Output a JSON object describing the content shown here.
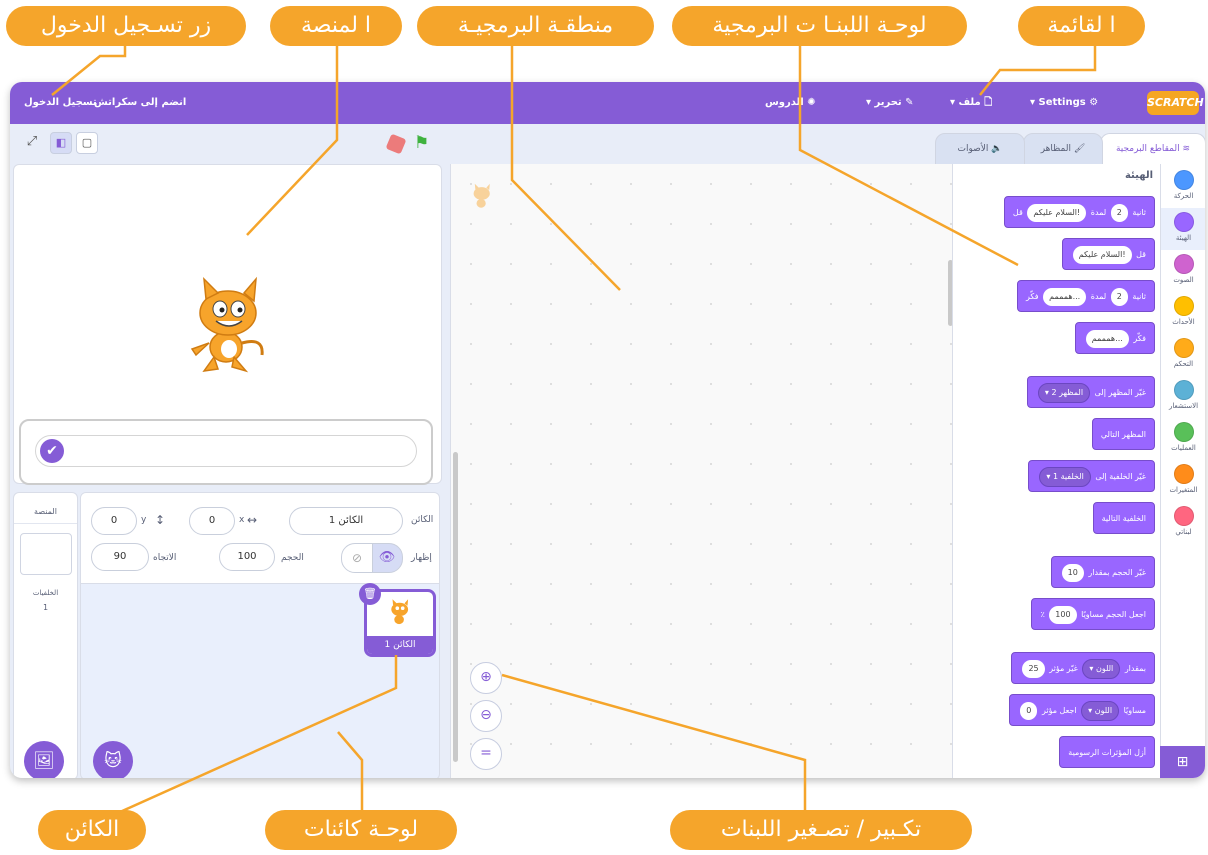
{
  "menu": {
    "logo": "SCRATCH",
    "settings": "Settings",
    "file": "ملف",
    "edit": "تحرير",
    "tutorials": "الدروس",
    "join": "انضم إلى سكراتش",
    "signin": "تسجيل الدخول"
  },
  "tabs": {
    "code": "المقاطع البرمجية",
    "costumes": "المظاهر",
    "sounds": "الأصوات"
  },
  "categories": [
    {
      "label": "الحركة",
      "color": "#4c97ff"
    },
    {
      "label": "الهيئة",
      "color": "#9966ff"
    },
    {
      "label": "الصوت",
      "color": "#cf63cf"
    },
    {
      "label": "الأحداث",
      "color": "#ffbf00"
    },
    {
      "label": "التحكم",
      "color": "#ffab19"
    },
    {
      "label": "الاستشعار",
      "color": "#5cb1d6"
    },
    {
      "label": "العمليات",
      "color": "#59c059"
    },
    {
      "label": "المتغيرات",
      "color": "#ff8c1a"
    },
    {
      "label": "لبناتي",
      "color": "#ff6680"
    }
  ],
  "palette": {
    "title": "الهيئة",
    "say_for": {
      "say": "قل",
      "text": "السلام عليكم!",
      "for": "لمدة",
      "secs": "2",
      "unit": "ثانية"
    },
    "say": {
      "say": "قل",
      "text": "السلام عليكم!"
    },
    "think_for": {
      "think": "فكّر",
      "text": "همممم...",
      "for": "لمدة",
      "secs": "2",
      "unit": "ثانية"
    },
    "think": {
      "think": "فكّر",
      "text": "همممم..."
    },
    "switch_costume": {
      "label": "غيّر المظهر إلى",
      "value": "المظهر 2"
    },
    "next_costume": "المظهر التالي",
    "switch_backdrop": {
      "label": "غيّر الخلفية إلى",
      "value": "الخلفية 1"
    },
    "next_backdrop": "الخلفية التالية",
    "change_size": {
      "label": "غيّر الحجم بمقدار",
      "value": "10"
    },
    "set_size": {
      "label": "اجعل الحجم مساويًا",
      "value": "100",
      "unit": "٪"
    },
    "change_effect": {
      "label": "غيّر مؤثر",
      "effect": "اللون",
      "by": "بمقدار",
      "value": "25"
    },
    "set_effect": {
      "label": "اجعل مؤثر",
      "effect": "اللون",
      "to": "مساويًا",
      "value": "0"
    },
    "clear_effects": "أزل المؤثرات الرسومية"
  },
  "sprite_info": {
    "sprite_label": "الكائن",
    "sprite_name": "الكائن 1",
    "x_label": "x",
    "x_value": "0",
    "y_label": "y",
    "y_value": "0",
    "show_label": "إظهار",
    "size_label": "الحجم",
    "size_value": "100",
    "direction_label": "الاتجاه",
    "direction_value": "90"
  },
  "sprite_card": {
    "name": "الكائن 1"
  },
  "stage_panel": {
    "title": "المنصة",
    "backdrops_label": "الخلفيات",
    "backdrops_count": "1"
  },
  "callouts": {
    "signin": "زر تسـجيل الدخول",
    "stage": "ا لمنصة",
    "code_area": "منطقـة البرمجيـة",
    "blocks_palette": "لوحـة اللبنـا ت البرمجية",
    "menu": "ا لقائمة",
    "sprite": "الكائن",
    "sprite_pane": "لوحـة كائنات",
    "zoom": "تكـبير / تصـغير اللبنات"
  },
  "colors": {
    "accent": "#855cd6",
    "callout": "#f5a52b",
    "looks": "#9966ff"
  }
}
